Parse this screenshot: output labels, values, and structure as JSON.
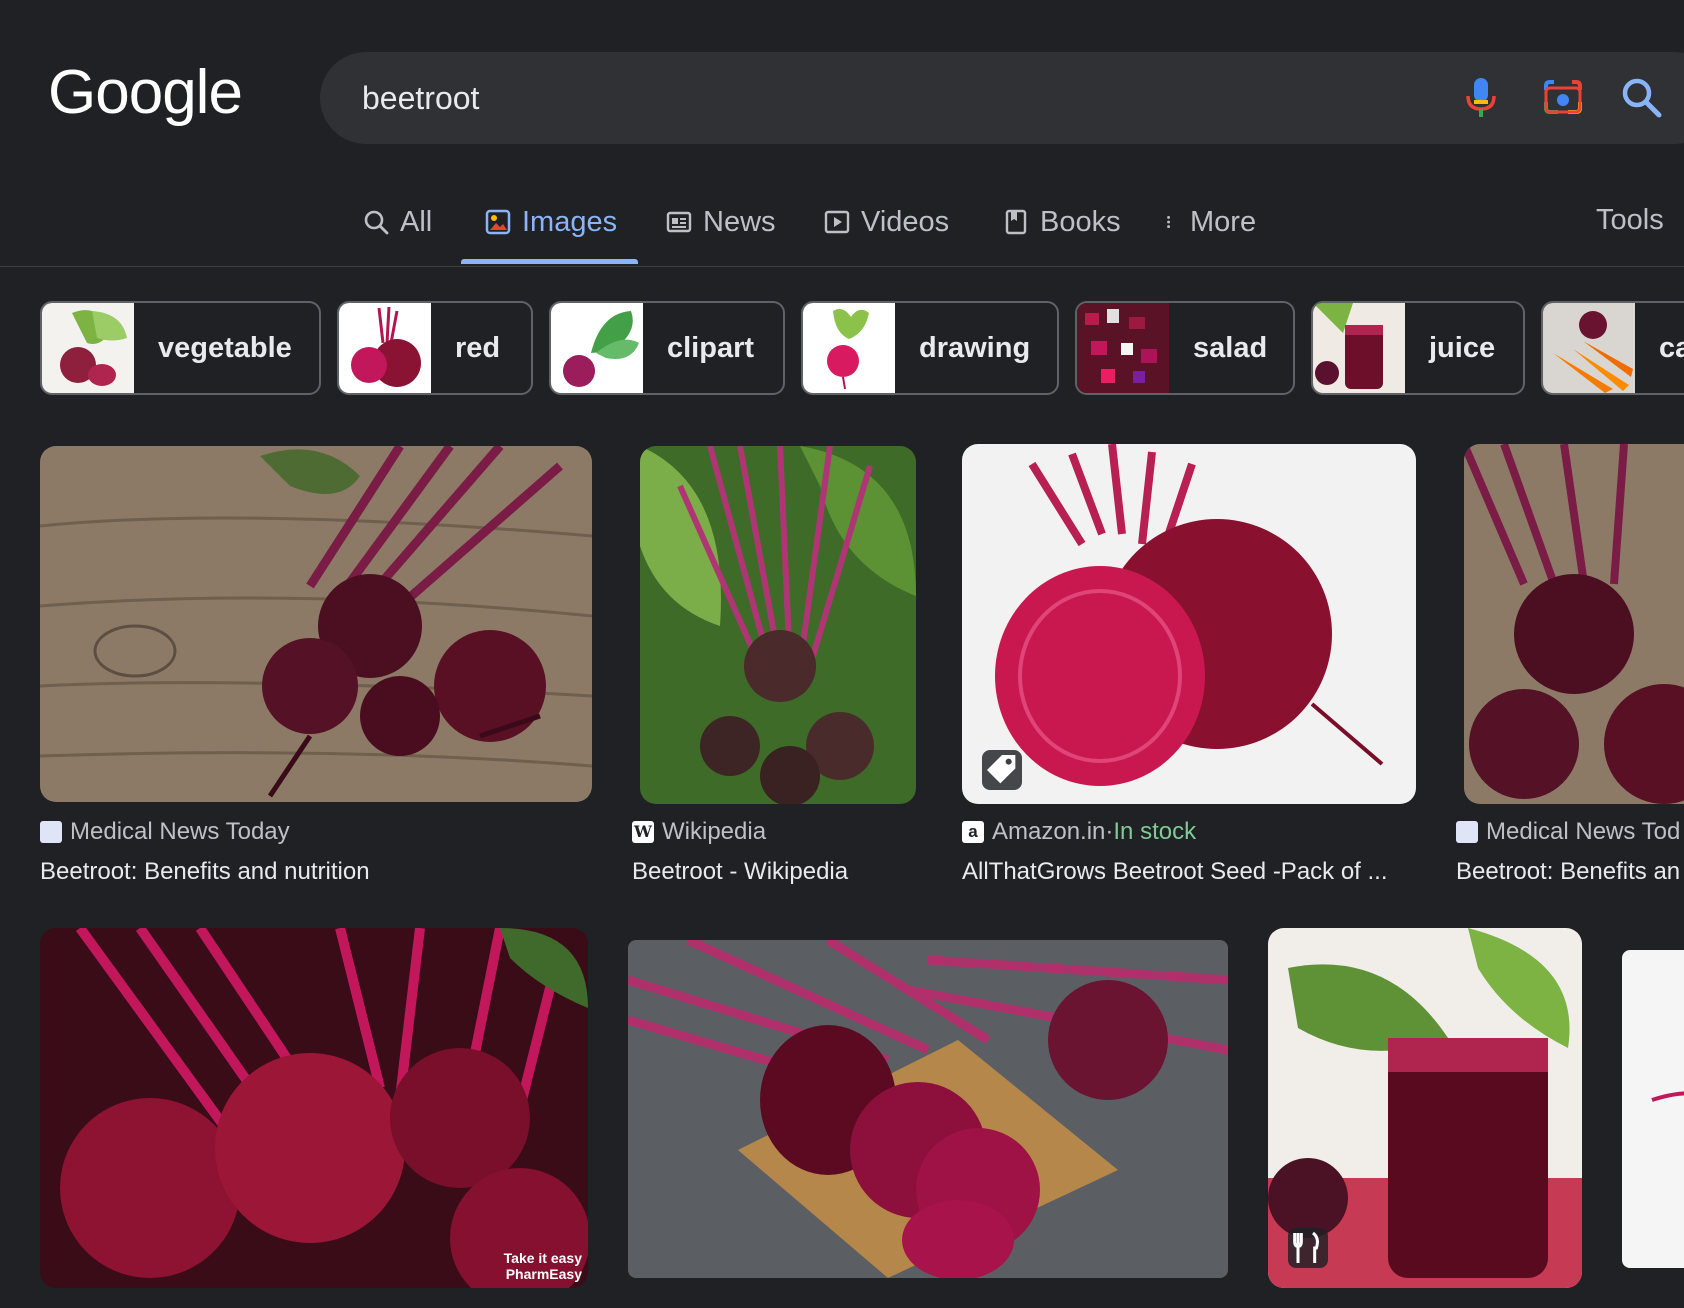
{
  "header": {
    "logo_text": "Google",
    "search_value": "beetroot"
  },
  "tabs": [
    {
      "label": "All",
      "icon": "search-icon",
      "active": false
    },
    {
      "label": "Images",
      "icon": "image-icon",
      "active": true
    },
    {
      "label": "News",
      "icon": "news-icon",
      "active": false
    },
    {
      "label": "Videos",
      "icon": "play-icon",
      "active": false
    },
    {
      "label": "Books",
      "icon": "book-icon",
      "active": false
    },
    {
      "label": "More",
      "icon": "more-vert-icon",
      "active": false
    }
  ],
  "tools_label": "Tools",
  "chips": [
    {
      "label": "vegetable"
    },
    {
      "label": "red"
    },
    {
      "label": "clipart"
    },
    {
      "label": "drawing"
    },
    {
      "label": "salad"
    },
    {
      "label": "juice"
    },
    {
      "label": "ca"
    }
  ],
  "results": [
    {
      "source": "Medical News Today",
      "title": "Beetroot: Benefits and nutrition"
    },
    {
      "source": "Wikipedia",
      "title": "Beetroot - Wikipedia"
    },
    {
      "source": "Amazon.in",
      "source_sep": " · ",
      "badge": "In stock",
      "title": "AllThatGrows Beetroot Seed -Pack of ..."
    },
    {
      "source": "Medical News Tod",
      "title": "Beetroot: Benefits an"
    }
  ],
  "images": [
    {
      "watermark": "Take it easy PharmEasy"
    }
  ],
  "colors": {
    "background": "#202124",
    "accent": "#8ab4f8",
    "in_stock": "#81c995"
  }
}
